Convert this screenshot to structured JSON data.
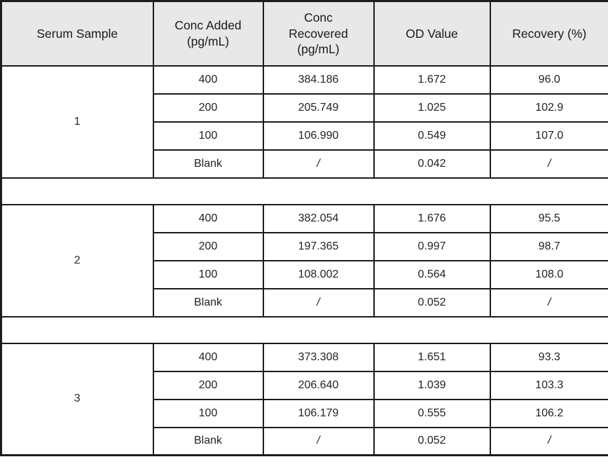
{
  "table": {
    "columns": [
      {
        "key": "serum_sample",
        "label": "Serum Sample"
      },
      {
        "key": "conc_added",
        "label": "Conc Added\n(pg/mL)",
        "line1": "Conc Added",
        "line2": "(pg/mL)"
      },
      {
        "key": "conc_recovered",
        "label": "Conc Recovered\n(pg/mL)",
        "line1": "Conc",
        "line2": "Recovered",
        "line3": "(pg/mL)"
      },
      {
        "key": "od_value",
        "label": "OD Value"
      },
      {
        "key": "recovery_pct",
        "label": "Recovery (%)"
      }
    ],
    "blocks": [
      {
        "sample": "1",
        "rows": [
          {
            "conc_added": "400",
            "conc_recovered": "384.186",
            "od_value": "1.672",
            "recovery_pct": "96.0"
          },
          {
            "conc_added": "200",
            "conc_recovered": "205.749",
            "od_value": "1.025",
            "recovery_pct": "102.9"
          },
          {
            "conc_added": "100",
            "conc_recovered": "106.990",
            "od_value": "0.549",
            "recovery_pct": "107.0"
          },
          {
            "conc_added": "Blank",
            "conc_recovered": "/",
            "od_value": "0.042",
            "recovery_pct": "/"
          }
        ]
      },
      {
        "sample": "2",
        "rows": [
          {
            "conc_added": "400",
            "conc_recovered": "382.054",
            "od_value": "1.676",
            "recovery_pct": "95.5"
          },
          {
            "conc_added": "200",
            "conc_recovered": "197.365",
            "od_value": "0.997",
            "recovery_pct": "98.7"
          },
          {
            "conc_added": "100",
            "conc_recovered": "108.002",
            "od_value": "0.564",
            "recovery_pct": "108.0"
          },
          {
            "conc_added": "Blank",
            "conc_recovered": "/",
            "od_value": "0.052",
            "recovery_pct": "/"
          }
        ]
      },
      {
        "sample": "3",
        "rows": [
          {
            "conc_added": "400",
            "conc_recovered": "373.308",
            "od_value": "1.651",
            "recovery_pct": "93.3"
          },
          {
            "conc_added": "200",
            "conc_recovered": "206.640",
            "od_value": "1.039",
            "recovery_pct": "103.3"
          },
          {
            "conc_added": "100",
            "conc_recovered": "106.179",
            "od_value": "0.555",
            "recovery_pct": "106.2"
          },
          {
            "conc_added": "Blank",
            "conc_recovered": "/",
            "od_value": "0.052",
            "recovery_pct": "/"
          }
        ]
      }
    ]
  },
  "style": {
    "header_background": "#e8e8e8",
    "border_color": "#1c1c1c",
    "text_color": "#232323",
    "page_background": "#ffffff"
  }
}
